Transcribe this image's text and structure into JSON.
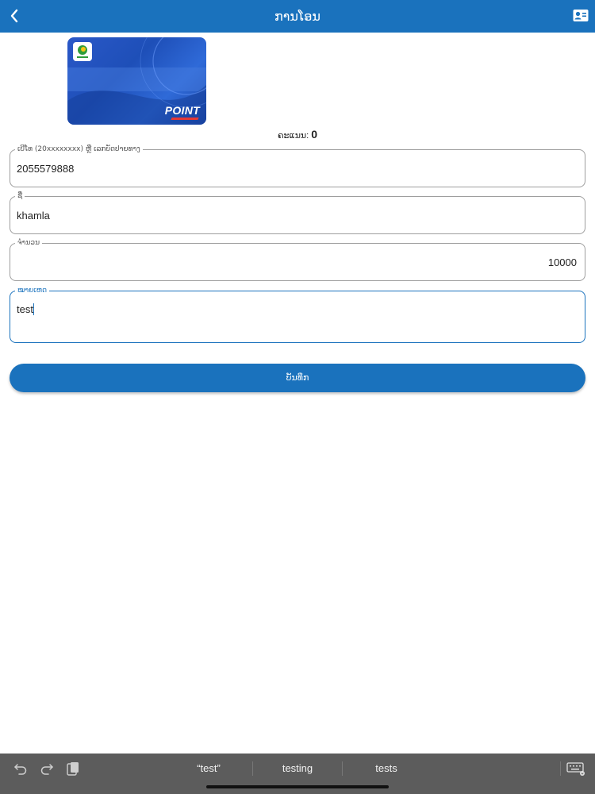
{
  "header": {
    "title": "ການໂອນ",
    "back_icon": "chevron-left-icon",
    "contact_icon": "contact-card-icon",
    "color": "#1a72bd"
  },
  "card": {
    "brand_text": "POINT",
    "logo_icon": "brand-logo-icon"
  },
  "score": {
    "label": "ຄະແນນ:",
    "value": "0"
  },
  "form": {
    "phone": {
      "label": "ເບີໂທ (20xxxxxxxx) ຫຼື ເລກບັດປາຍທາງ",
      "value": "2055579888"
    },
    "name": {
      "label": "ຊື່",
      "value": "khamla"
    },
    "amount": {
      "label": "ຈຳນວນ",
      "value": "10000"
    },
    "note": {
      "label": "ໝາຍເຫດ",
      "value": "test"
    }
  },
  "save_button": {
    "label": "ບັນທຶກ"
  },
  "keyboard_bar": {
    "undo_icon": "undo-icon",
    "redo_icon": "redo-icon",
    "paste_icon": "paste-icon",
    "suggestions": [
      "“test”",
      "testing",
      "tests"
    ],
    "keyboard_icon": "keyboard-hide-icon"
  }
}
